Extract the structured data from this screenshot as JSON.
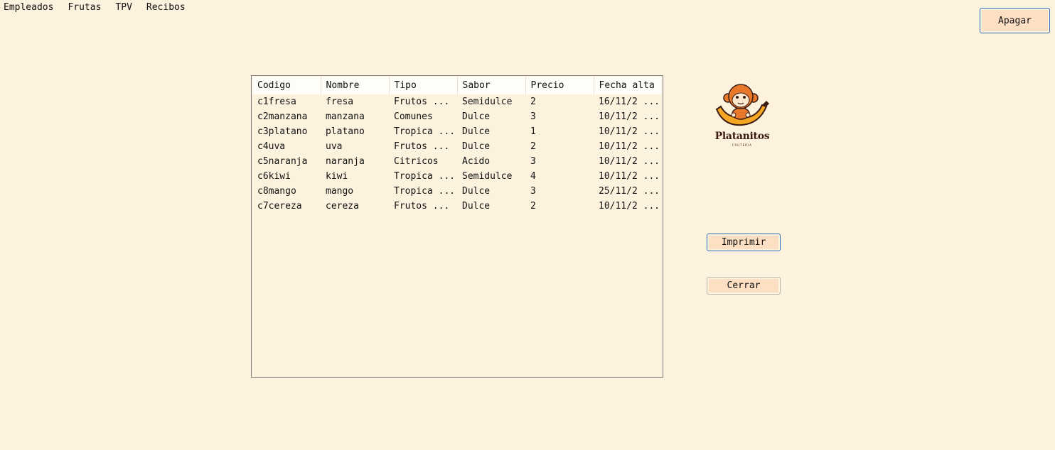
{
  "menu": {
    "items": [
      {
        "label": "Empleados"
      },
      {
        "label": "Frutas"
      },
      {
        "label": "TPV"
      },
      {
        "label": "Recibos"
      }
    ]
  },
  "buttons": {
    "apagar": "Apagar",
    "imprimir": "Imprimir",
    "cerrar": "Cerrar"
  },
  "logo": {
    "title": "Platanitos",
    "subtitle": "FRUTERIA",
    "icon": "monkey-banana-icon",
    "colors": {
      "monkey": "#e8782a",
      "banana": "#f5a623",
      "outline": "#3b1d14"
    }
  },
  "table": {
    "columns": [
      "Codigo",
      "Nombre",
      "Tipo",
      "Sabor",
      "Precio",
      "Fecha alta"
    ],
    "rows": [
      [
        "c1fresa",
        "fresa",
        "Frutos ...",
        "Semidulce",
        "2",
        "16/11/2 ..."
      ],
      [
        "c2manzana",
        "manzana",
        "Comunes",
        "Dulce",
        "3",
        "10/11/2 ..."
      ],
      [
        "c3platano",
        "platano",
        "Tropica ...",
        "Dulce",
        "1",
        "10/11/2 ..."
      ],
      [
        "c4uva",
        "uva",
        "Frutos ...",
        "Dulce",
        "2",
        "10/11/2 ..."
      ],
      [
        "c5naranja",
        "naranja",
        "Citricos",
        "Acido",
        "3",
        "10/11/2 ..."
      ],
      [
        "c6kiwi",
        "kiwi",
        "Tropica ...",
        "Semidulce",
        "4",
        "10/11/2 ..."
      ],
      [
        "c8mango",
        "mango",
        "Tropica ...",
        "Dulce",
        "3",
        "25/11/2 ..."
      ],
      [
        "c7cereza",
        "cereza",
        "Frutos ...",
        "Dulce",
        "2",
        "10/11/2 ..."
      ]
    ]
  },
  "colors": {
    "background": "#fdf2de",
    "button_fill": "#fde0c4",
    "focus_border": "#2d6fb5"
  }
}
